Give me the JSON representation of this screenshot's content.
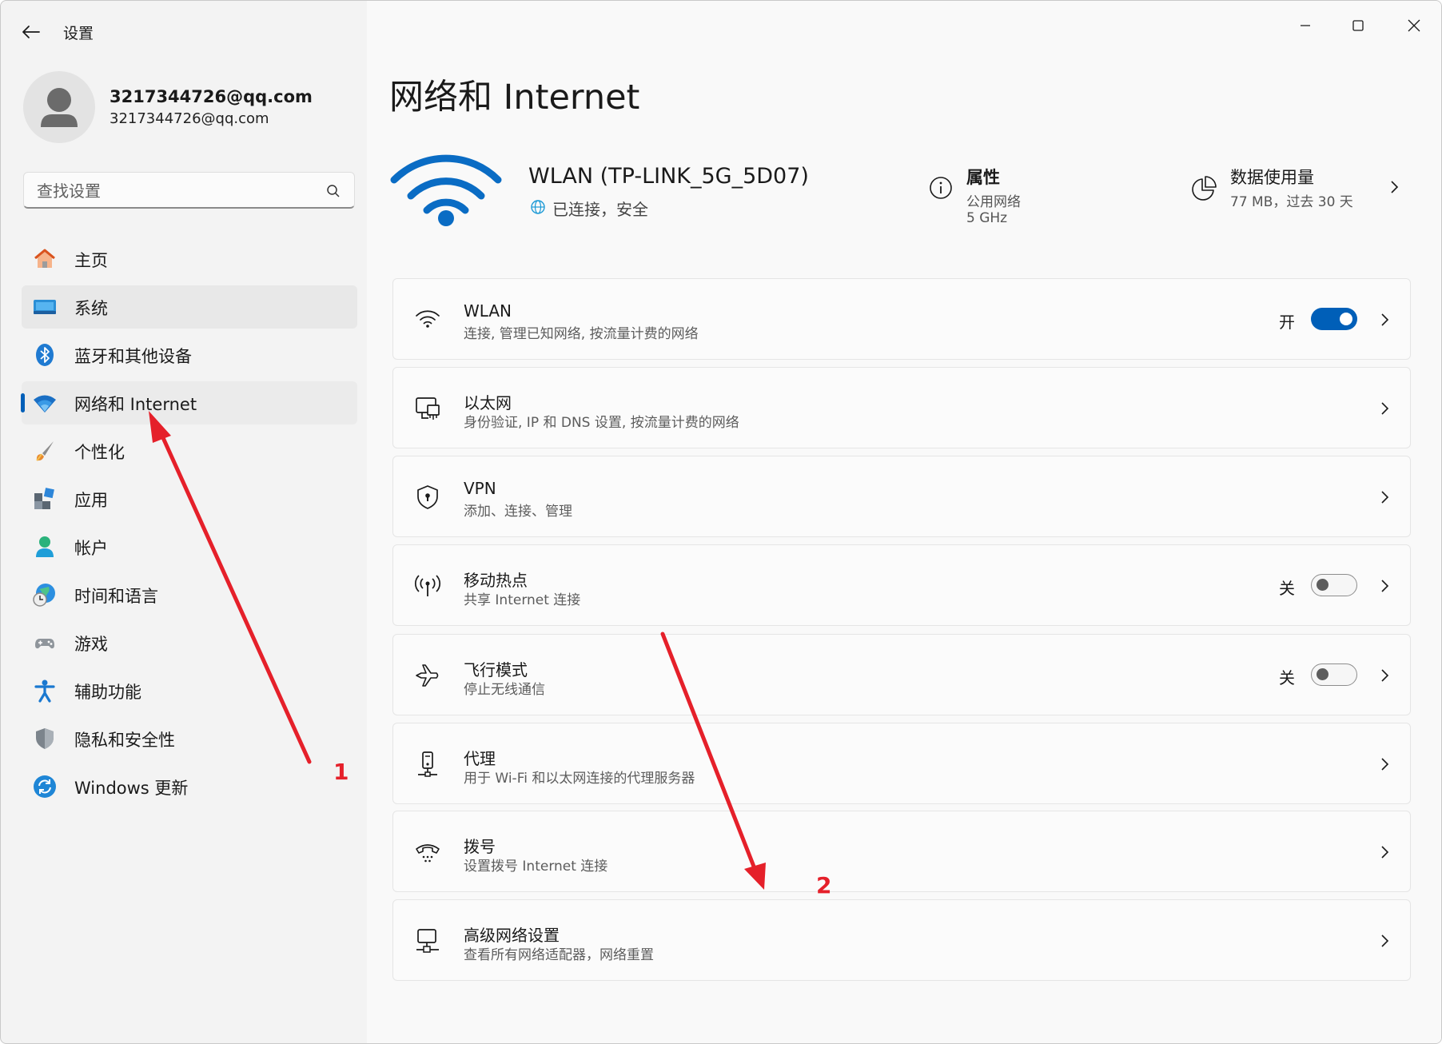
{
  "window": {
    "title": "设置"
  },
  "account": {
    "name": "3217344726@qq.com",
    "email": "3217344726@qq.com"
  },
  "search": {
    "placeholder": "查找设置"
  },
  "sidebar": {
    "items": [
      {
        "label": "主页",
        "icon": "home-icon"
      },
      {
        "label": "系统",
        "icon": "system-display-icon"
      },
      {
        "label": "蓝牙和其他设备",
        "icon": "bluetooth-icon"
      },
      {
        "label": "网络和 Internet",
        "icon": "wifi-icon"
      },
      {
        "label": "个性化",
        "icon": "paintbrush-icon"
      },
      {
        "label": "应用",
        "icon": "apps-icon"
      },
      {
        "label": "帐户",
        "icon": "account-icon"
      },
      {
        "label": "时间和语言",
        "icon": "globe-clock-icon"
      },
      {
        "label": "游戏",
        "icon": "gamepad-icon"
      },
      {
        "label": "辅助功能",
        "icon": "accessibility-icon"
      },
      {
        "label": "隐私和安全性",
        "icon": "shield-icon"
      },
      {
        "label": "Windows 更新",
        "icon": "update-icon"
      }
    ],
    "selected": "网络和 Internet"
  },
  "main": {
    "title": "网络和 Internet",
    "connection": {
      "name": "WLAN (TP-LINK_5G_5D07)",
      "status": "已连接，安全"
    },
    "properties": {
      "title": "属性",
      "network_type": "公用网络",
      "band": "5 GHz"
    },
    "data_usage": {
      "title": "数据使用量",
      "summary": "77 MB，过去 30 天"
    },
    "cards": [
      {
        "title": "WLAN",
        "subtitle": "连接, 管理已知网络, 按流量计费的网络",
        "icon": "wifi-icon",
        "toggle_label": "开",
        "toggle_on": true
      },
      {
        "title": "以太网",
        "subtitle": "身份验证, IP 和 DNS 设置, 按流量计费的网络",
        "icon": "ethernet-icon"
      },
      {
        "title": "VPN",
        "subtitle": "添加、连接、管理",
        "icon": "vpn-shield-icon"
      },
      {
        "title": "移动热点",
        "subtitle": "共享 Internet 连接",
        "icon": "hotspot-icon",
        "toggle_label": "关",
        "toggle_on": false
      },
      {
        "title": "飞行模式",
        "subtitle": "停止无线通信",
        "icon": "airplane-icon",
        "toggle_label": "关",
        "toggle_on": false
      },
      {
        "title": "代理",
        "subtitle": "用于 Wi-Fi 和以太网连接的代理服务器",
        "icon": "proxy-icon"
      },
      {
        "title": "拨号",
        "subtitle": "设置拨号 Internet 连接",
        "icon": "dialup-phone-icon"
      },
      {
        "title": "高级网络设置",
        "subtitle": "查看所有网络适配器，网络重置",
        "icon": "advanced-network-icon"
      }
    ]
  },
  "annotations": {
    "label1": "1",
    "label2": "2",
    "color": "#e5202a"
  },
  "colors": {
    "accent": "#005fb8"
  }
}
